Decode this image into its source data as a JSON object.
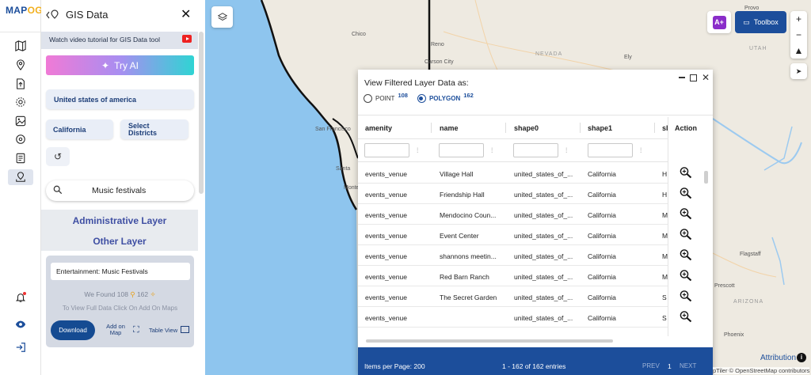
{
  "app": {
    "logo_main": "MAP",
    "logo_accent": "OG"
  },
  "panel": {
    "title": "GIS Data",
    "tutorial": "Watch video tutorial for GIS Data tool",
    "try_ai": "Try AI",
    "country": "United states of america",
    "state": "California",
    "districts_line1": "Select",
    "districts_line2": "Districts",
    "search_value": "Music festivals",
    "admin_layer": "Administrative Layer",
    "other_layer": "Other Layer",
    "result_layer": "Entertainment: Music Festivals",
    "found_prefix": "We Found",
    "found_points": "108",
    "found_polygons": "162",
    "hint": "To View Full Data Click On Add On Maps",
    "download": "Download",
    "add_on_map_1": "Add on",
    "add_on_map_2": "Map",
    "table_view": "Table View"
  },
  "map_controls": {
    "toolbox": "Toolbox",
    "zoom_in": "+",
    "zoom_out": "−"
  },
  "map_labels": [
    {
      "text": "Chico",
      "kind": "city"
    },
    {
      "text": "Reno",
      "kind": "city"
    },
    {
      "text": "Carson City",
      "kind": "city"
    },
    {
      "text": "Provo",
      "kind": "city"
    },
    {
      "text": "NEVADA",
      "kind": "region"
    },
    {
      "text": "UTAH",
      "kind": "region"
    },
    {
      "text": "Ely",
      "kind": "city"
    },
    {
      "text": "San Francisco",
      "kind": "city"
    },
    {
      "text": "Santa",
      "kind": "city"
    },
    {
      "text": "Monte",
      "kind": "city"
    },
    {
      "text": "Flagstaff",
      "kind": "city"
    },
    {
      "text": "Prescott",
      "kind": "city"
    },
    {
      "text": "ARIZONA",
      "kind": "region"
    },
    {
      "text": "Phoenix",
      "kind": "city"
    }
  ],
  "modal": {
    "title": "View Filtered Layer Data as:",
    "point_label": "POINT",
    "point_count": "108",
    "polygon_label": "POLYGON",
    "polygon_count": "162",
    "columns": [
      "amenity",
      "name",
      "shape0",
      "shape1",
      "sl",
      "Action"
    ],
    "rows": [
      [
        "events_venue",
        "Village Hall",
        "united_states_of_...",
        "California",
        "H"
      ],
      [
        "events_venue",
        "Friendship Hall",
        "united_states_of_...",
        "California",
        "H"
      ],
      [
        "events_venue",
        "Mendocino Coun...",
        "united_states_of_...",
        "California",
        "M"
      ],
      [
        "events_venue",
        "Event Center",
        "united_states_of_...",
        "California",
        "M"
      ],
      [
        "events_venue",
        "shannons meetin...",
        "united_states_of_...",
        "California",
        "M"
      ],
      [
        "events_venue",
        "Red Barn Ranch",
        "united_states_of_...",
        "California",
        "M"
      ],
      [
        "events_venue",
        "The Secret Garden",
        "united_states_of_...",
        "California",
        "S"
      ],
      [
        "events_venue",
        "",
        "united_states_of_...",
        "California",
        "S"
      ]
    ],
    "items_per_page": "Items per Page: 200",
    "entries": "1 - 162 of 162 entries",
    "prev": "PREV",
    "page": "1",
    "next": "NEXT"
  },
  "attribution": "Attribution",
  "copyright": "pTiler © OpenStreetMap contributors",
  "colors": {
    "brand": "#1c4e9b",
    "ocean": "#8ec5ee",
    "accent": "#f2b01e"
  }
}
